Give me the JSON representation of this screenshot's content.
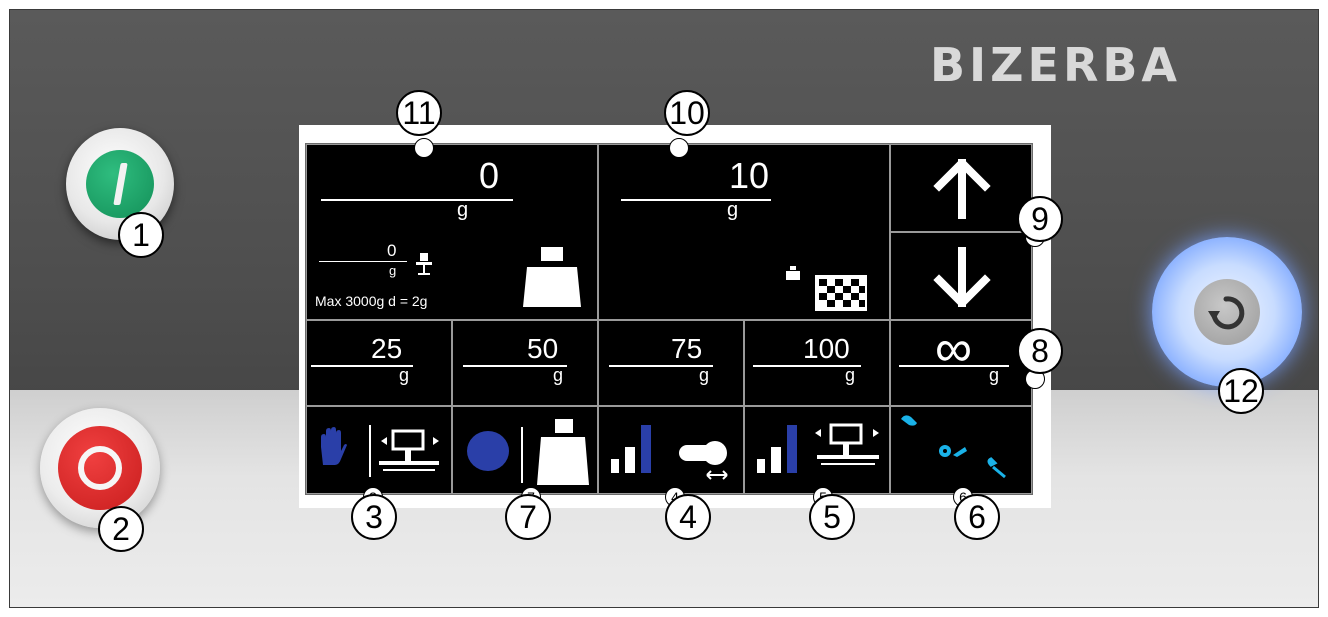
{
  "brand": "BIZERBA",
  "display": {
    "weight": {
      "value": "0",
      "unit": "g"
    },
    "tare": {
      "value": "0",
      "unit": "g"
    },
    "capacity_text": "Max 3000g  d = 2g",
    "target": {
      "value": "10",
      "unit": "g"
    },
    "presets": [
      {
        "value": "25",
        "unit": "g"
      },
      {
        "value": "50",
        "unit": "g"
      },
      {
        "value": "75",
        "unit": "g"
      },
      {
        "value": "100",
        "unit": "g"
      },
      {
        "value": "∞",
        "unit": "g"
      }
    ],
    "colors": {
      "screen_bg": "#000000",
      "icon_blue": "#2a3fa8",
      "icon_cyan": "#1ab2e8"
    }
  },
  "callouts": [
    "1",
    "2",
    "3",
    "4",
    "5",
    "6",
    "7",
    "8",
    "9",
    "10",
    "11",
    "12"
  ],
  "small_markers": [
    "3",
    "7",
    "4",
    "5",
    "6"
  ],
  "physical_buttons": {
    "on": {
      "icon": "power-on-icon",
      "color": "#1fa66a"
    },
    "off": {
      "icon": "power-off-icon",
      "color": "#e02424"
    },
    "reset": {
      "icon": "refresh-icon",
      "glow": "#6a8cff"
    }
  }
}
